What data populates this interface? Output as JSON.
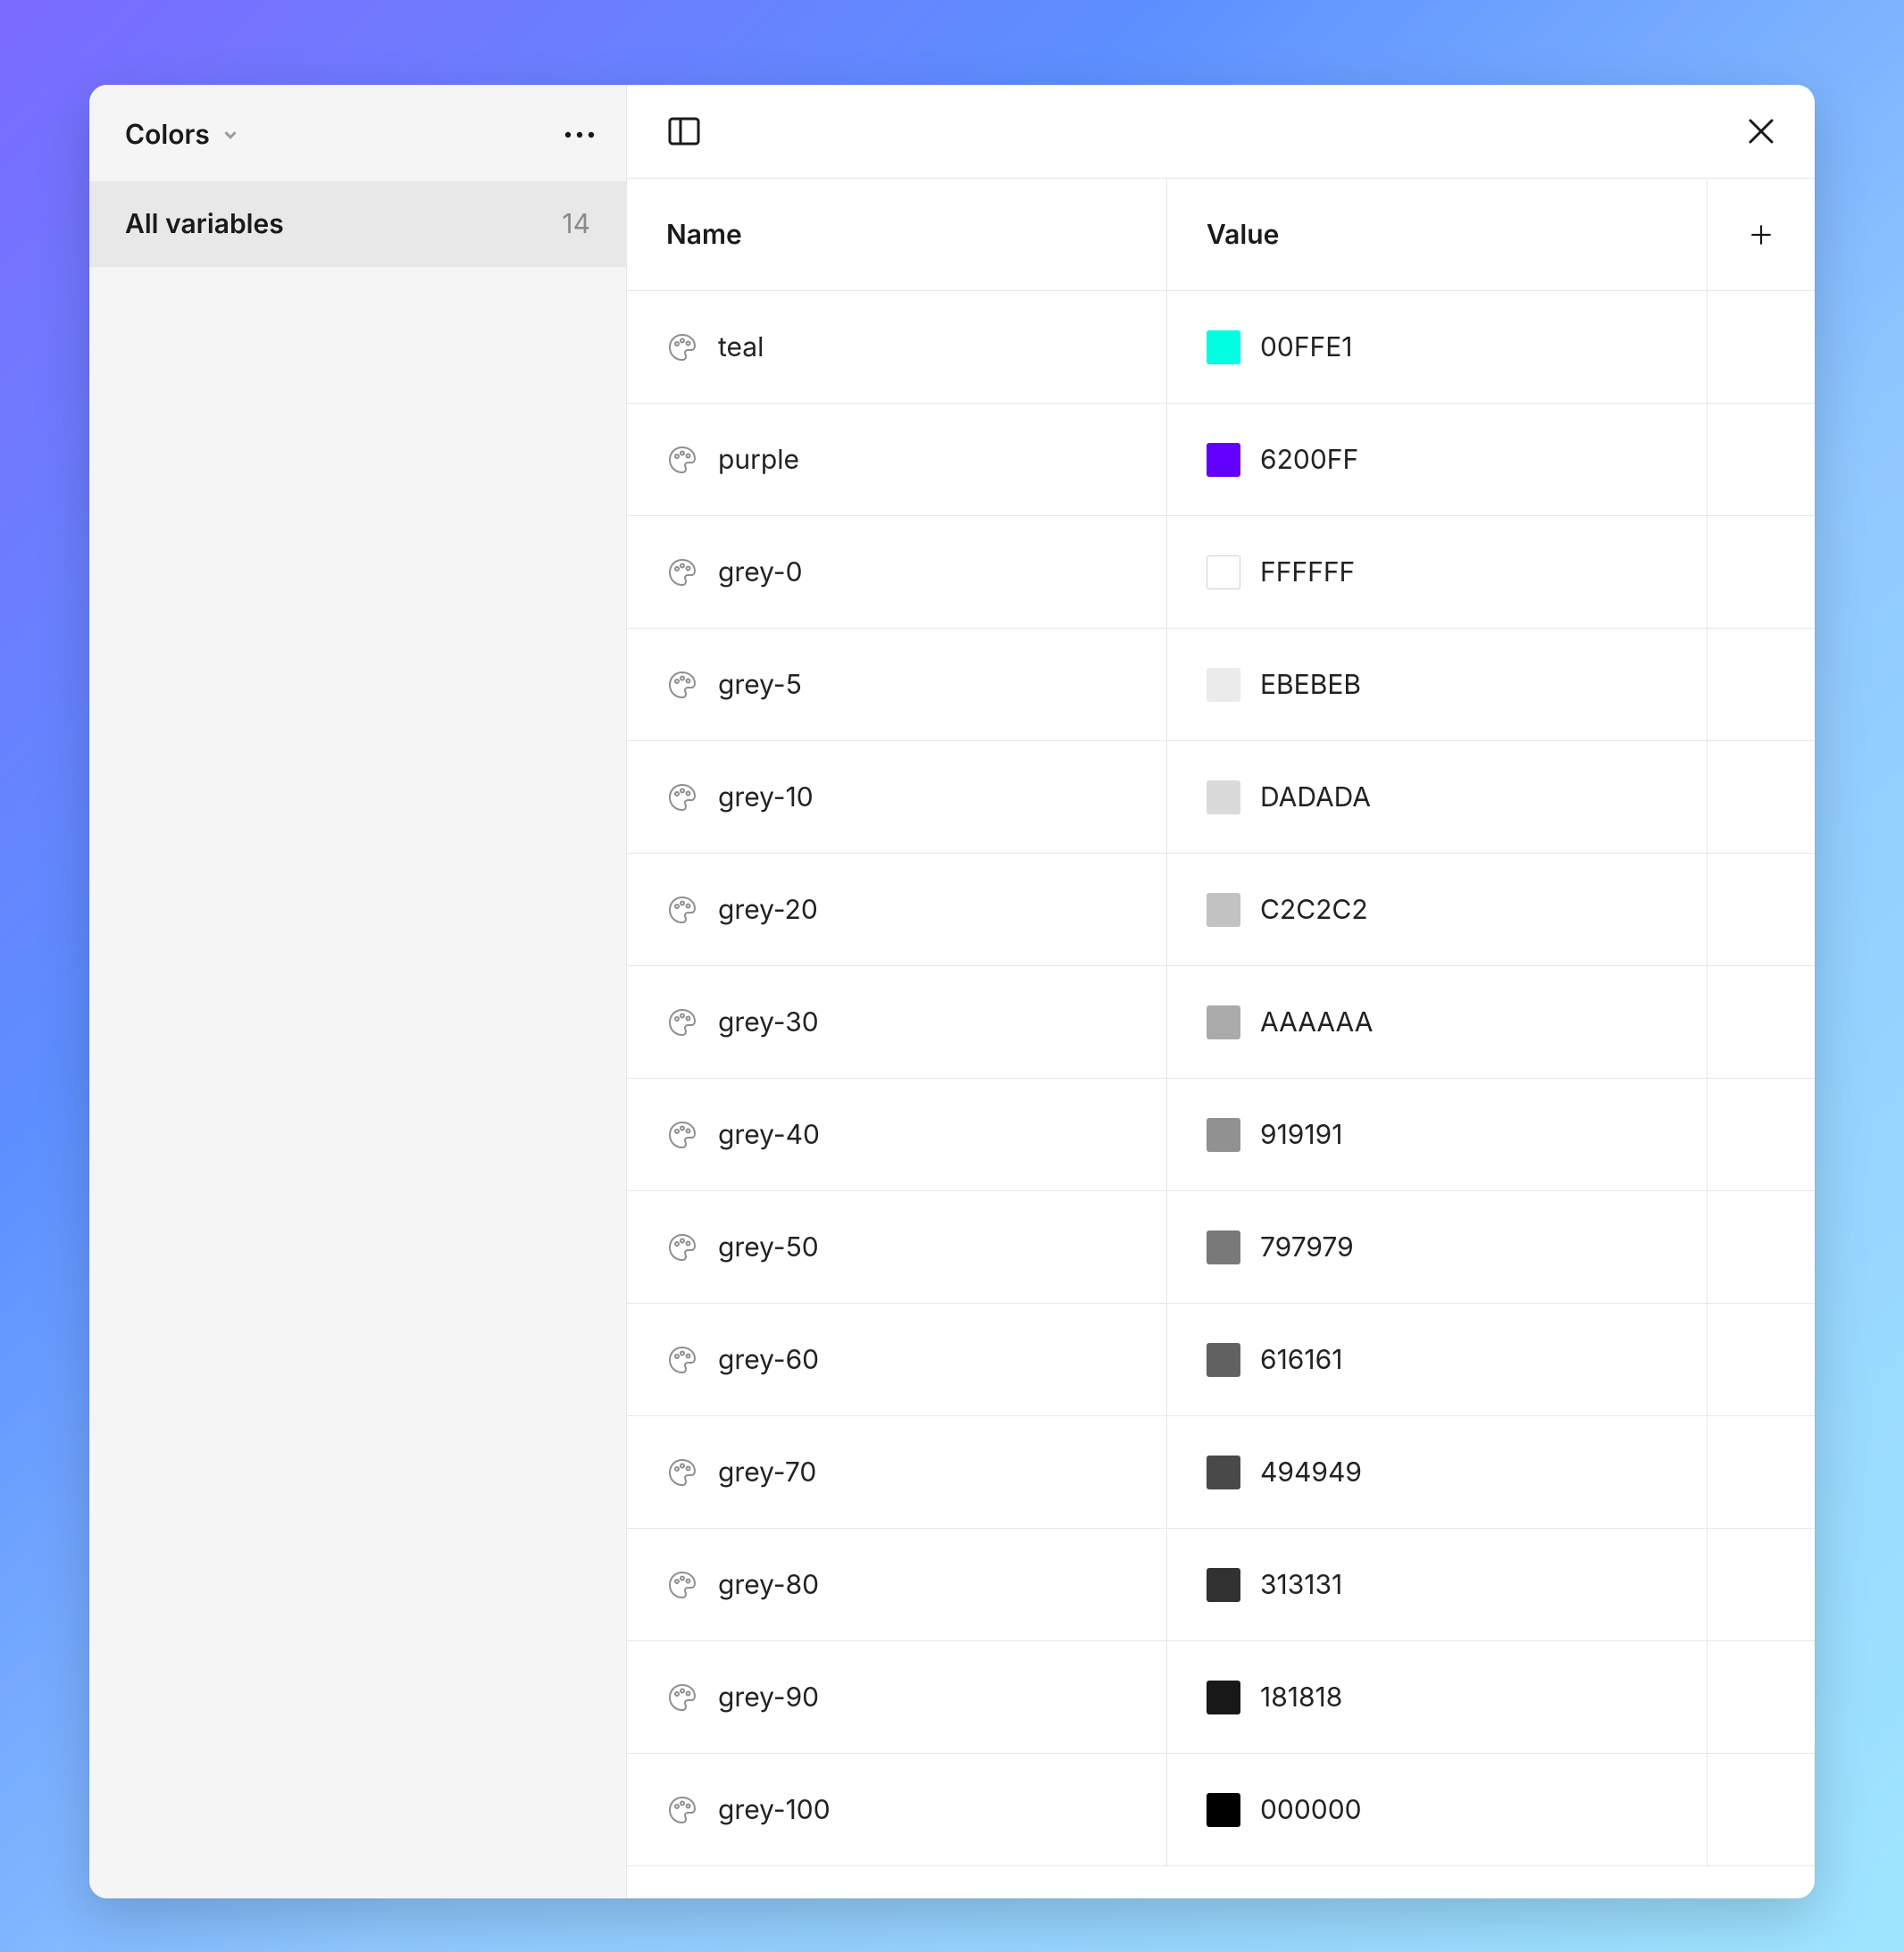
{
  "sidebar": {
    "collection_name": "Colors",
    "groups": [
      {
        "label": "All variables",
        "count": "14"
      }
    ]
  },
  "table": {
    "headers": {
      "name": "Name",
      "value": "Value"
    },
    "rows": [
      {
        "name": "teal",
        "value_label": "00FFE1",
        "swatch": "#00FFE1",
        "border": false
      },
      {
        "name": "purple",
        "value_label": "6200FF",
        "swatch": "#6200FF",
        "border": false
      },
      {
        "name": "grey-0",
        "value_label": "FFFFFF",
        "swatch": "#FFFFFF",
        "border": true
      },
      {
        "name": "grey-5",
        "value_label": "EBEBEB",
        "swatch": "#EBEBEB",
        "border": false
      },
      {
        "name": "grey-10",
        "value_label": "DADADA",
        "swatch": "#DADADA",
        "border": false
      },
      {
        "name": "grey-20",
        "value_label": "C2C2C2",
        "swatch": "#C2C2C2",
        "border": false
      },
      {
        "name": "grey-30",
        "value_label": "AAAAAA",
        "swatch": "#AAAAAA",
        "border": false
      },
      {
        "name": "grey-40",
        "value_label": "919191",
        "swatch": "#919191",
        "border": false
      },
      {
        "name": "grey-50",
        "value_label": "797979",
        "swatch": "#797979",
        "border": false
      },
      {
        "name": "grey-60",
        "value_label": "616161",
        "swatch": "#616161",
        "border": false
      },
      {
        "name": "grey-70",
        "value_label": "494949",
        "swatch": "#494949",
        "border": false
      },
      {
        "name": "grey-80",
        "value_label": "313131",
        "swatch": "#313131",
        "border": false
      },
      {
        "name": "grey-90",
        "value_label": "181818",
        "swatch": "#181818",
        "border": false
      },
      {
        "name": "grey-100",
        "value_label": "000000",
        "swatch": "#000000",
        "border": false
      }
    ]
  }
}
